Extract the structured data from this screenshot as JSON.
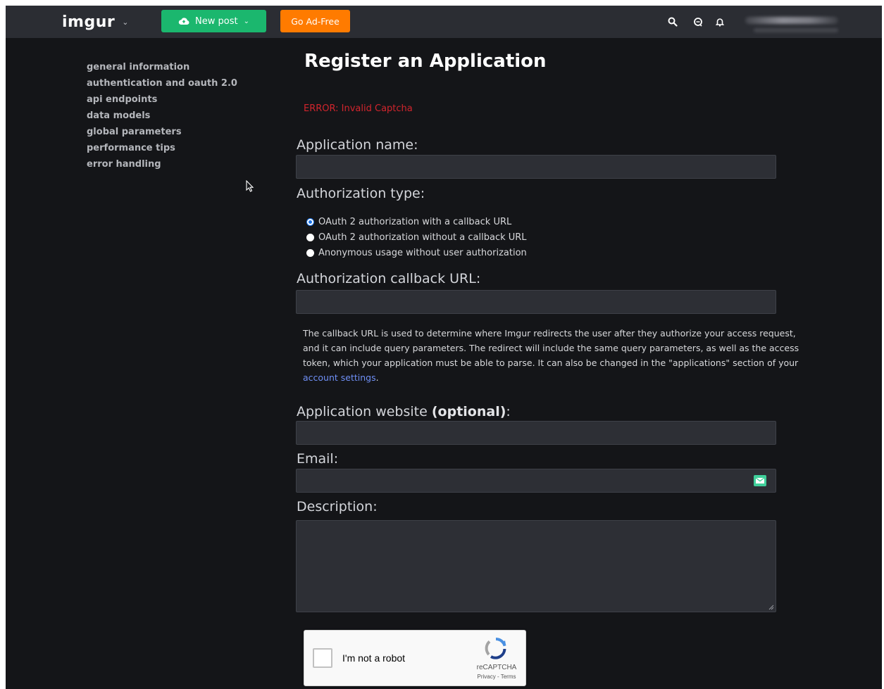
{
  "topbar": {
    "logo": "imgur",
    "new_post": "New post",
    "go_ad_free": "Go Ad-Free",
    "icons": [
      "search-icon",
      "chat-icon",
      "bell-icon"
    ]
  },
  "sidenav": {
    "items": [
      {
        "label": "general information"
      },
      {
        "label": "authentication and oauth 2.0"
      },
      {
        "label": "api endpoints"
      },
      {
        "label": "data models"
      },
      {
        "label": "global parameters"
      },
      {
        "label": "performance tips"
      },
      {
        "label": "error handling"
      }
    ]
  },
  "form": {
    "title": "Register an Application",
    "error": "ERROR: Invalid Captcha",
    "app_name_label": "Application name:",
    "app_name_value": "",
    "auth_type_label": "Authorization type:",
    "auth_options": [
      {
        "label": "OAuth 2 authorization with a callback URL",
        "checked": true
      },
      {
        "label": "OAuth 2 authorization without a callback URL",
        "checked": false
      },
      {
        "label": "Anonymous usage without user authorization",
        "checked": false
      }
    ],
    "callback_label": "Authorization callback URL:",
    "callback_value": "",
    "help_text": "The callback URL is used to determine where Imgur redirects the user after they authorize your access request, and it can include query parameters. The redirect will include the same query parameters, as well as the access token, which your application must be able to parse. It can also be changed in the \"applications\" section of your ",
    "help_link": "account settings",
    "help_end": ".",
    "website_label": "Application website ",
    "website_optional": "(optional)",
    "website_colon": ":",
    "website_value": "",
    "email_label": "Email:",
    "email_value": "",
    "description_label": "Description:",
    "description_value": ""
  },
  "recaptcha": {
    "label": "I'm not a robot",
    "brand": "reCAPTCHA",
    "links": "Privacy - Terms"
  },
  "colors": {
    "new_post": "#1bb76e",
    "go_ad_free": "#ff7b00",
    "error": "#d1252d",
    "link": "#6f8ff5",
    "background": "#141518"
  }
}
